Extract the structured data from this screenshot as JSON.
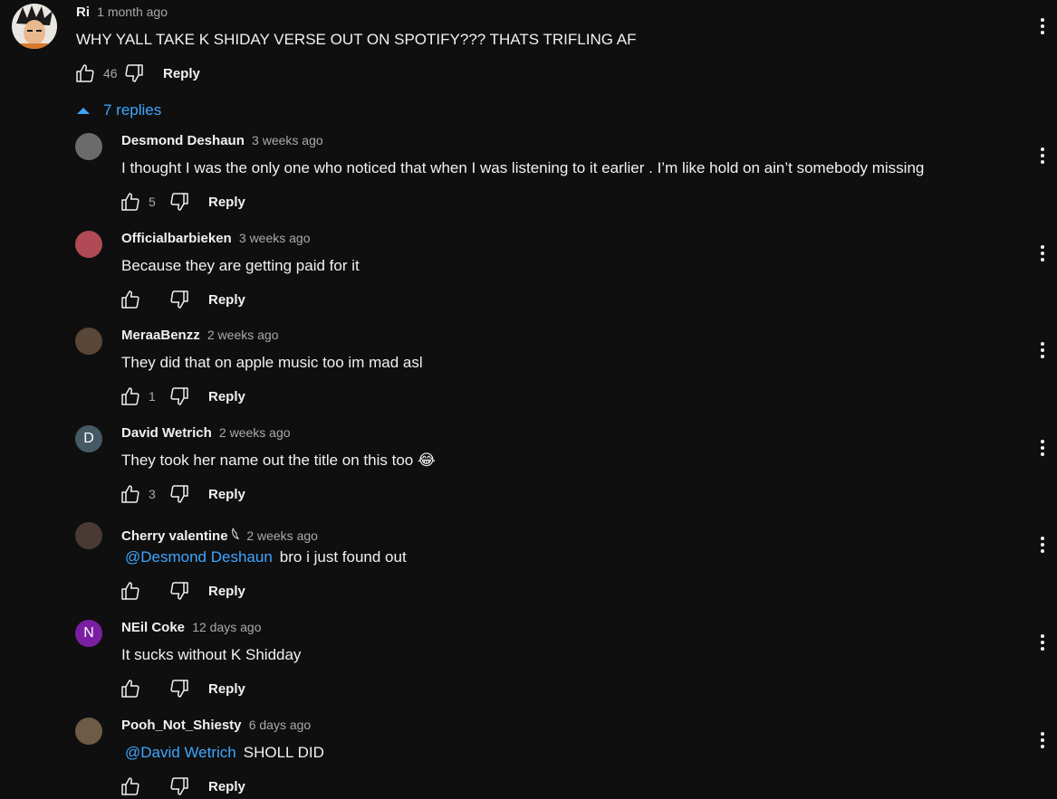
{
  "colors": {
    "background": "#0f0f0f",
    "text": "#f1f1f1",
    "muted": "#aaaaaa",
    "link": "#3ea6ff"
  },
  "top_comment": {
    "author": "Ri",
    "time": "1 month ago",
    "text": "WHY YALL TAKE K SHIDAY VERSE OUT ON SPOTIFY??? THATS TRIFLING AF",
    "likes": "46",
    "reply_label": "Reply",
    "avatar": "goku-avatar"
  },
  "replies_toggle": {
    "label": "7 replies",
    "icon": "chevron-up-icon"
  },
  "replies": [
    {
      "author": "Desmond Deshaun",
      "time": "3 weeks ago",
      "mention": "",
      "text": "I thought I was the only one who noticed that when I was listening to it earlier . I’m like hold on ain’t somebody missing",
      "likes": "5",
      "reply_label": "Reply",
      "avatar_letter": "",
      "avatar_color": "#6b6b6b"
    },
    {
      "author": "Officialbarbieken",
      "time": "3 weeks ago",
      "mention": "",
      "text": "Because they are getting paid for it",
      "likes": "",
      "reply_label": "Reply",
      "avatar_letter": "",
      "avatar_color": "#b04a55"
    },
    {
      "author": "MeraaBenzz",
      "time": "2 weeks ago",
      "mention": "",
      "text": "They did that on apple music too im mad asl",
      "likes": "1",
      "reply_label": "Reply",
      "avatar_letter": "",
      "avatar_color": "#5a4636"
    },
    {
      "author": "David Wetrich",
      "time": "2 weeks ago",
      "mention": "",
      "text": "They took her name out the title on this too 😂",
      "likes": "3",
      "reply_label": "Reply",
      "avatar_letter": "D",
      "avatar_color": "#455a64"
    },
    {
      "author": "Cherry valentine 𓆩",
      "time": "2 weeks ago",
      "mention": "@Desmond Deshaun",
      "text": "bro i just found out",
      "likes": "",
      "reply_label": "Reply",
      "avatar_letter": "",
      "avatar_color": "#4a3a34"
    },
    {
      "author": "NEil Coke",
      "time": "12 days ago",
      "mention": "",
      "text": "It sucks without K Shidday",
      "likes": "",
      "reply_label": "Reply",
      "avatar_letter": "N",
      "avatar_color": "#7b1fa2"
    },
    {
      "author": "Pooh_Not_Shiesty",
      "time": "6 days ago",
      "mention": "@David Wetrich",
      "text": "SHOLL DID",
      "likes": "",
      "reply_label": "Reply",
      "avatar_letter": "",
      "avatar_color": "#6e5b45"
    }
  ]
}
